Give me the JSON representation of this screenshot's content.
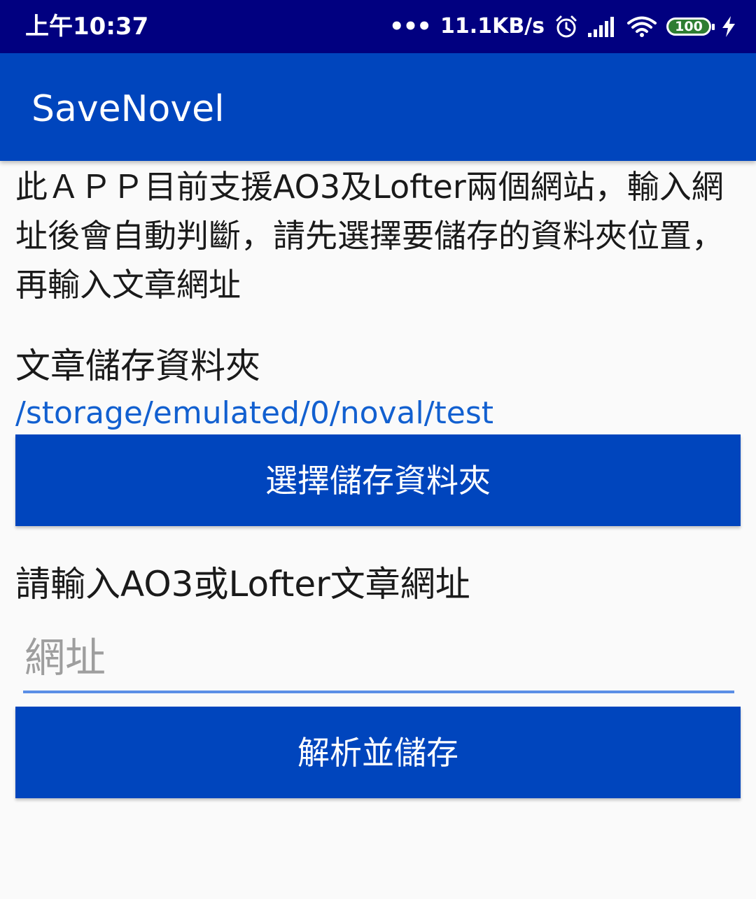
{
  "status_bar": {
    "time": "上午10:37",
    "dots": "•••",
    "speed": "11.1KB/s",
    "battery": "100",
    "icons": [
      "alarm-icon",
      "signal-icon",
      "wifi-icon",
      "battery-icon",
      "charging-icon"
    ],
    "battery_color": "#2e7d32",
    "background": "#010080"
  },
  "app_bar": {
    "title": "SaveNovel",
    "background": "#0045bd"
  },
  "main": {
    "description": "此ＡＰＰ目前支援AO3及Lofter兩個網站，輸入網址後會自動判斷，請先選擇要儲存的資料夾位置，再輸入文章網址",
    "folder_label": "文章儲存資料夾",
    "folder_path": "/storage/emulated/0/noval/test",
    "choose_folder_button": "選擇儲存資料夾",
    "url_label": "請輸入AO3或Lofter文章網址",
    "url_input": {
      "value": "",
      "placeholder": "網址"
    },
    "parse_button": "解析並儲存"
  },
  "colors": {
    "accent": "#0045bd",
    "link": "#1260d0",
    "input_underline": "#5b8fe6"
  }
}
